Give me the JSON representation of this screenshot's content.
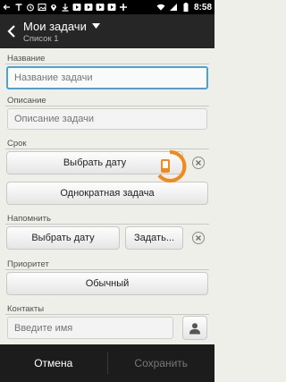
{
  "status": {
    "time": "8:58",
    "left_icons": [
      "back-arrow-icon",
      "text-icon",
      "alarm-icon",
      "image-icon",
      "location-icon",
      "download-icon",
      "play-icon",
      "play-icon",
      "play-icon",
      "play-icon",
      "cross-icon"
    ],
    "right_icons": [
      "wifi-icon",
      "signal-icon",
      "battery-icon"
    ]
  },
  "actionbar": {
    "title": "Мои задачи",
    "subtitle": "Список 1"
  },
  "form": {
    "name_label": "Название",
    "name_placeholder": "Название задачи",
    "description_label": "Описание",
    "description_placeholder": "Описание задачи",
    "due_label": "Срок",
    "due_date_button": "Выбрать дату",
    "repeat_button": "Однократная задача",
    "remind_label": "Напомнить",
    "remind_date_button": "Выбрать дату",
    "remind_set_button": "Задать...",
    "priority_label": "Приоритет",
    "priority_button": "Обычный",
    "contacts_label": "Контакты",
    "contacts_placeholder": "Введите имя"
  },
  "bottom": {
    "cancel": "Отмена",
    "save": "Сохранить"
  },
  "colors": {
    "focus_border": "#4aa2d6",
    "watermark": "#f08a1c",
    "bar_bg": "#262626"
  }
}
